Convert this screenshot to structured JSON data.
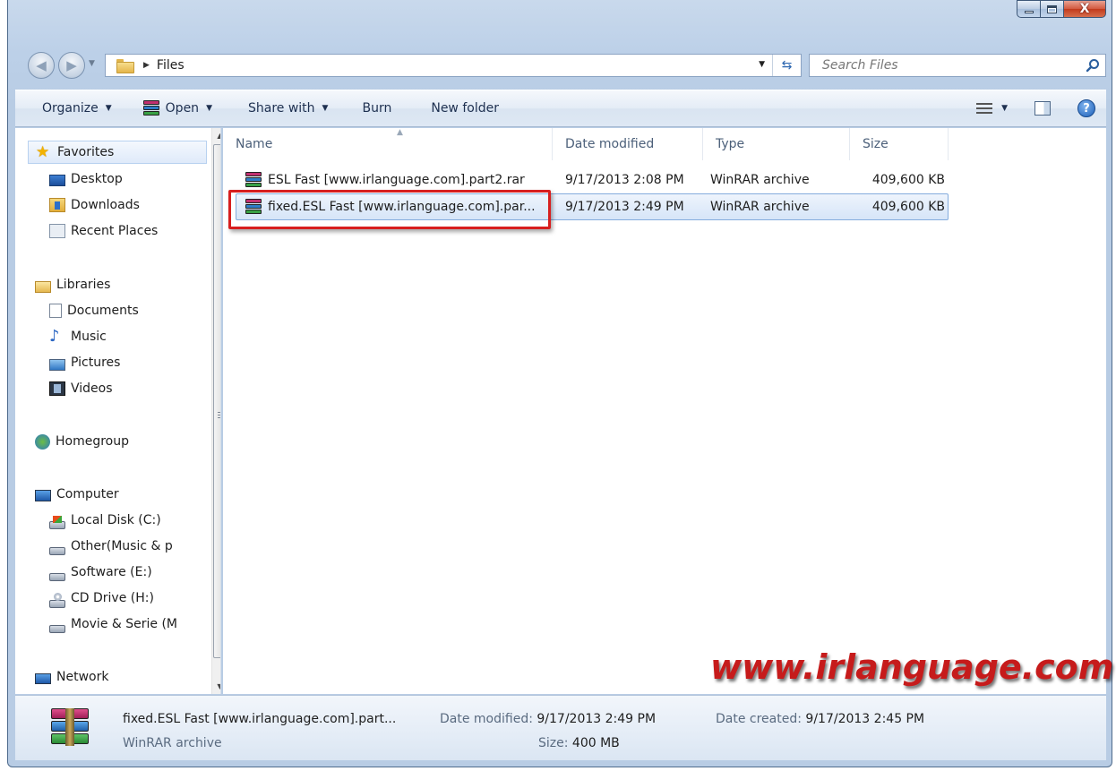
{
  "window": {
    "close_glyph": "X"
  },
  "address_bar": {
    "path": "Files",
    "search_placeholder": "Search Files"
  },
  "toolbar": {
    "organize": "Organize",
    "open": "Open",
    "share_with": "Share with",
    "burn": "Burn",
    "new_folder": "New folder",
    "help_glyph": "?"
  },
  "nav_pane": {
    "favorites": "Favorites",
    "desktop": "Desktop",
    "downloads": "Downloads",
    "recent_places": "Recent Places",
    "libraries": "Libraries",
    "documents": "Documents",
    "music": "Music",
    "pictures": "Pictures",
    "videos": "Videos",
    "homegroup": "Homegroup",
    "computer": "Computer",
    "local_disk": "Local Disk (C:)",
    "other": "Other(Music & p",
    "software": "Software (E:)",
    "cd_drive": "CD Drive (H:)",
    "movie": "Movie & Serie (M",
    "network": "Network"
  },
  "file_list": {
    "columns": {
      "name": "Name",
      "date_modified": "Date modified",
      "type": "Type",
      "size": "Size"
    },
    "rows": [
      {
        "name": "ESL Fast [www.irlanguage.com].part2.rar",
        "date": "9/17/2013 2:08 PM",
        "type": "WinRAR archive",
        "size": "409,600 KB"
      },
      {
        "name": "fixed.ESL Fast [www.irlanguage.com].par...",
        "date": "9/17/2013 2:49 PM",
        "type": "WinRAR archive",
        "size": "409,600 KB"
      }
    ]
  },
  "watermark": "www.irlanguage.com",
  "details_pane": {
    "name": "fixed.ESL Fast [www.irlanguage.com].part...",
    "type": "WinRAR archive",
    "date_modified_label": "Date modified:",
    "date_modified": "9/17/2013 2:49 PM",
    "size_label": "Size:",
    "size": "400 MB",
    "date_created_label": "Date created:",
    "date_created": "9/17/2013 2:45 PM"
  },
  "colors": {
    "selection_border": "#84acdd",
    "highlight_box": "#d71f1f",
    "watermark": "#c61b1b"
  }
}
